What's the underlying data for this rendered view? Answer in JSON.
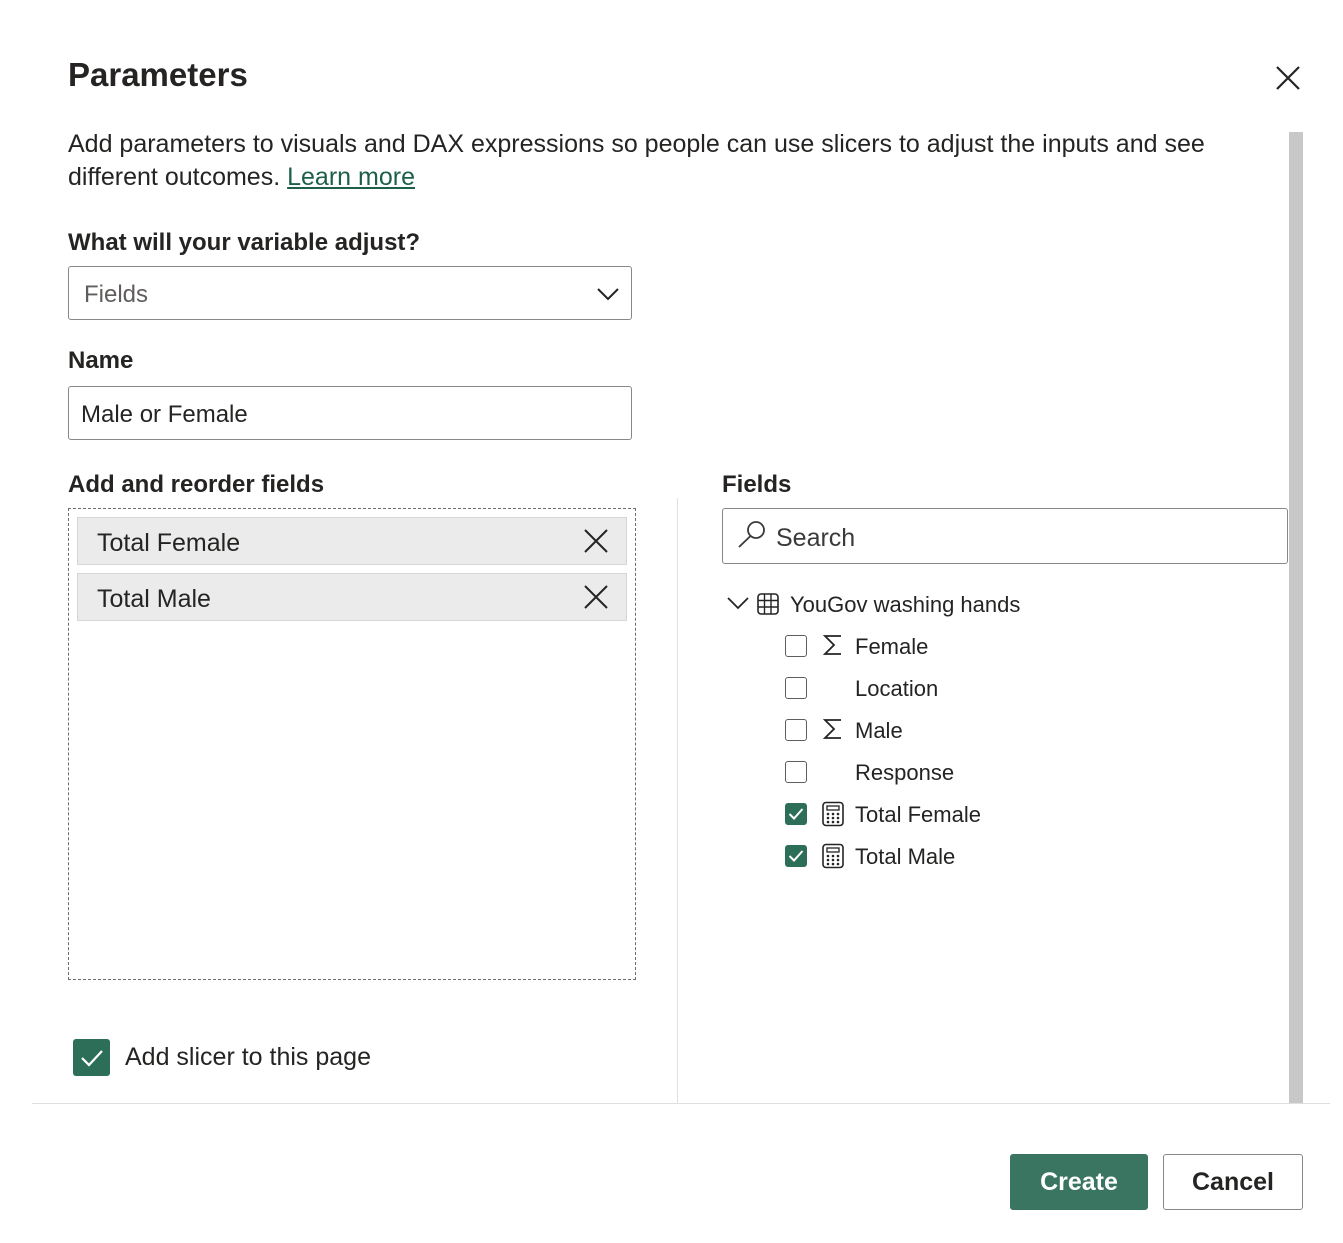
{
  "dialog": {
    "title": "Parameters",
    "description": "Add parameters to visuals and DAX expressions so people can use slicers to adjust the inputs and see different outcomes.",
    "learn_more": "Learn more"
  },
  "variable": {
    "label": "What will your variable adjust?",
    "selected": "Fields"
  },
  "name": {
    "label": "Name",
    "value": "Male or Female"
  },
  "reorder": {
    "label": "Add and reorder fields",
    "items": [
      {
        "label": "Total Female"
      },
      {
        "label": "Total Male"
      }
    ]
  },
  "fields_panel": {
    "label": "Fields",
    "search_placeholder": "Search",
    "table": {
      "name": "YouGov washing hands",
      "icon": "table-icon",
      "expanded": true
    },
    "items": [
      {
        "label": "Female",
        "icon": "sigma-icon",
        "checked": false
      },
      {
        "label": "Location",
        "icon": "",
        "checked": false
      },
      {
        "label": "Male",
        "icon": "sigma-icon",
        "checked": false
      },
      {
        "label": "Response",
        "icon": "",
        "checked": false
      },
      {
        "label": "Total Female",
        "icon": "calculator-icon",
        "checked": true
      },
      {
        "label": "Total Male",
        "icon": "calculator-icon",
        "checked": true
      }
    ]
  },
  "slicer": {
    "label": "Add slicer to this page",
    "checked": true
  },
  "buttons": {
    "create": "Create",
    "cancel": "Cancel"
  },
  "colors": {
    "accent": "#2c6e58",
    "primary_button": "#3a7562",
    "link": "#1e5f4a"
  }
}
